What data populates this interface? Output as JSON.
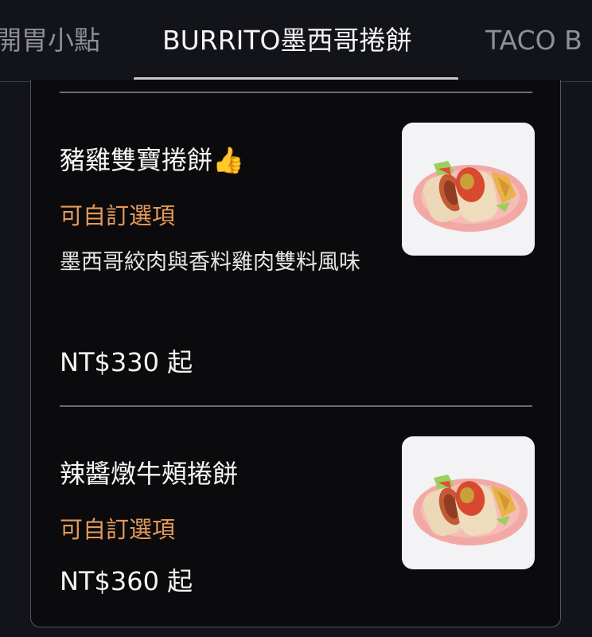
{
  "tabs": [
    {
      "label": "開胃小點",
      "active": false
    },
    {
      "label": "BURRITO墨西哥捲餅",
      "active": true
    },
    {
      "label": "TACO B",
      "active": false
    }
  ],
  "items": [
    {
      "title": "豬雞雙寶捲餅👍",
      "option": "可自訂選項",
      "description": "墨西哥絞肉與香料雞肉雙料風味",
      "price": "NT$330 起",
      "image_icon": "burrito-plate-image"
    },
    {
      "title": "辣醬燉牛頰捲餅",
      "option": "可自訂選項",
      "price": "NT$360 起",
      "image_icon": "burrito-plate-image"
    }
  ],
  "colors": {
    "background": "#131419",
    "card": "#0b0b0d",
    "option_accent": "#e59a5a"
  }
}
